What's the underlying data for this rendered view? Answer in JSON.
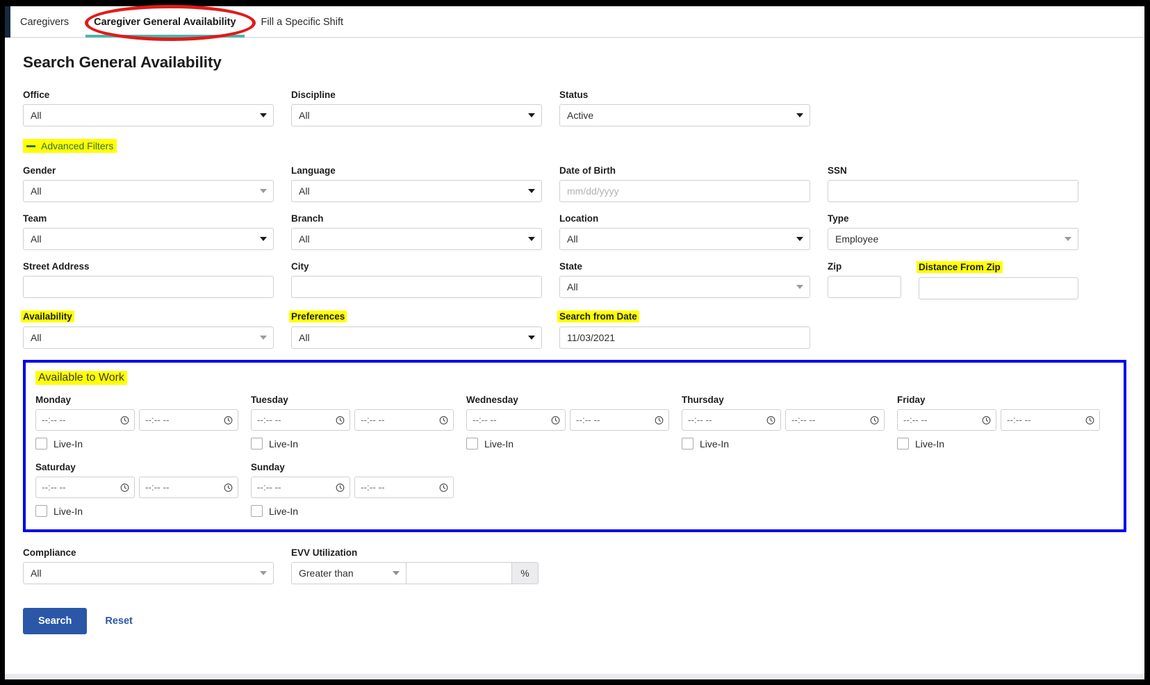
{
  "window": {
    "accent_blue": "#2b57a8",
    "highlight_yellow": "#ffff00",
    "annotation_red": "#e01b18",
    "annotation_blue": "#0000f0",
    "tab_underline_teal": "#4fb3ae"
  },
  "tabs": [
    {
      "label": "Caregivers",
      "active": false
    },
    {
      "label": "Caregiver General Availability",
      "active": true
    },
    {
      "label": "Fill a Specific Shift",
      "active": false
    }
  ],
  "page": {
    "title": "Search General Availability"
  },
  "advanced_filters": {
    "label": "Advanced Filters",
    "icon": "minus-icon",
    "expanded": true
  },
  "row1": {
    "office": {
      "label": "Office",
      "value": "All"
    },
    "discipline": {
      "label": "Discipline",
      "value": "All"
    },
    "status": {
      "label": "Status",
      "value": "Active"
    }
  },
  "row2": {
    "gender": {
      "label": "Gender",
      "value": "All"
    },
    "language": {
      "label": "Language",
      "value": "All"
    },
    "date_of_birth": {
      "label": "Date of Birth",
      "value": "",
      "placeholder": "mm/dd/yyyy"
    },
    "ssn": {
      "label": "SSN",
      "value": "",
      "placeholder": ""
    }
  },
  "row3": {
    "team": {
      "label": "Team",
      "value": "All"
    },
    "branch": {
      "label": "Branch",
      "value": "All"
    },
    "location": {
      "label": "Location",
      "value": "All"
    },
    "type": {
      "label": "Type",
      "value": "Employee"
    }
  },
  "row4": {
    "street_address": {
      "label": "Street Address",
      "value": "",
      "placeholder": ""
    },
    "city": {
      "label": "City",
      "value": "",
      "placeholder": ""
    },
    "state": {
      "label": "State",
      "value": "All"
    },
    "zip": {
      "label": "Zip",
      "value": "",
      "placeholder": ""
    },
    "distance_from_zip": {
      "label": "Distance From Zip",
      "value": "",
      "placeholder": "",
      "highlighted": true
    }
  },
  "row5": {
    "availability": {
      "label": "Availability",
      "value": "All",
      "highlighted": true
    },
    "preferences": {
      "label": "Preferences",
      "value": "All",
      "highlighted": true
    },
    "search_from_date": {
      "label": "Search from Date",
      "value": "11/03/2021",
      "highlighted": true
    }
  },
  "available_to_work": {
    "title": "Available to Work",
    "title_highlighted": true,
    "time_placeholder": "--:-- --",
    "livein_label": "Live-In",
    "clock_icon": "clock-icon",
    "days": [
      {
        "name": "Monday",
        "start": "",
        "end": "",
        "live_in": false
      },
      {
        "name": "Tuesday",
        "start": "",
        "end": "",
        "live_in": false
      },
      {
        "name": "Wednesday",
        "start": "",
        "end": "",
        "live_in": false
      },
      {
        "name": "Thursday",
        "start": "",
        "end": "",
        "live_in": false
      },
      {
        "name": "Friday",
        "start": "",
        "end": "",
        "live_in": false
      },
      {
        "name": "Saturday",
        "start": "",
        "end": "",
        "live_in": false
      },
      {
        "name": "Sunday",
        "start": "",
        "end": "",
        "live_in": false
      }
    ]
  },
  "row6": {
    "compliance": {
      "label": "Compliance",
      "value": "All"
    },
    "evv_utilization": {
      "label": "EVV Utilization",
      "operator": "Greater than",
      "amount": "",
      "suffix": "%"
    }
  },
  "actions": {
    "search_label": "Search",
    "reset_label": "Reset"
  }
}
